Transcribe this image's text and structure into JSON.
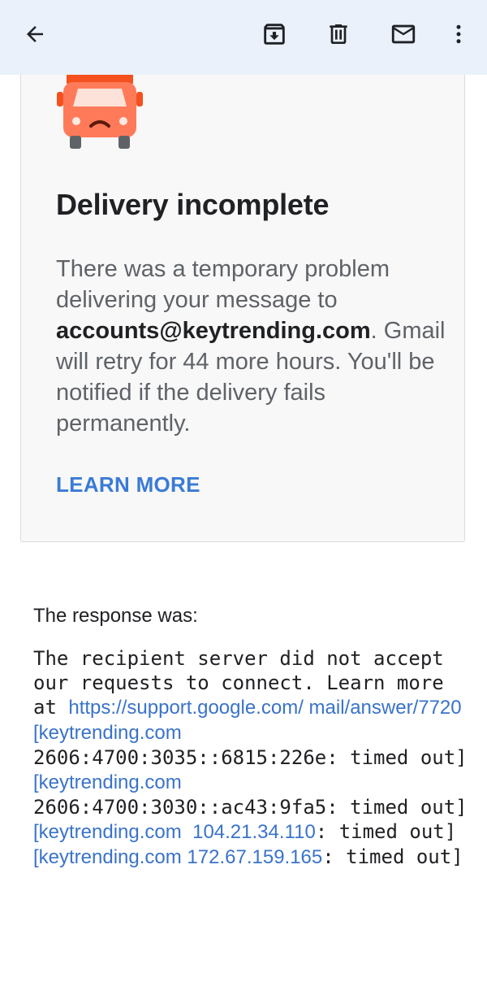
{
  "toolbar": {
    "back_icon": "arrow-left-icon",
    "archive_icon": "archive-icon",
    "delete_icon": "trash-icon",
    "mail_icon": "mail-unread-icon",
    "more_icon": "more-vert-icon"
  },
  "card": {
    "illustration": "truck-sad-icon",
    "title": "Delivery incomplete",
    "body_prefix": "There was a temporary problem delivering your message to ",
    "address": "accounts@keytrending.com",
    "body_suffix": ". Gmail will retry for 44 more hours. You'll be notified if the delivery fails permanently.",
    "learn_more": "LEARN MORE"
  },
  "response": {
    "label": "The response was:",
    "text1": "The recipient server did not accept our requests to connect. Learn more at ",
    "link1": "https://support.google.com/ mail/answer/7720",
    "text2": " ",
    "link2": "[keytrending.com",
    "text3": "2606:4700:3035::6815:226e: timed out] ",
    "link3": "[keytrending.com",
    "text4": "2606:4700:3030::ac43:9fa5: timed out] ",
    "link4": "[keytrending.com  104.21.34.110",
    "text5": ": timed out] ",
    "link5": "[keytrending.com 172.67.159.165",
    "text6": ": timed out]"
  },
  "colors": {
    "toolbar_bg": "#eaf1fb",
    "link": "#3a73c9",
    "learn_more": "#3a7bd5",
    "truck": "#f4511e"
  }
}
